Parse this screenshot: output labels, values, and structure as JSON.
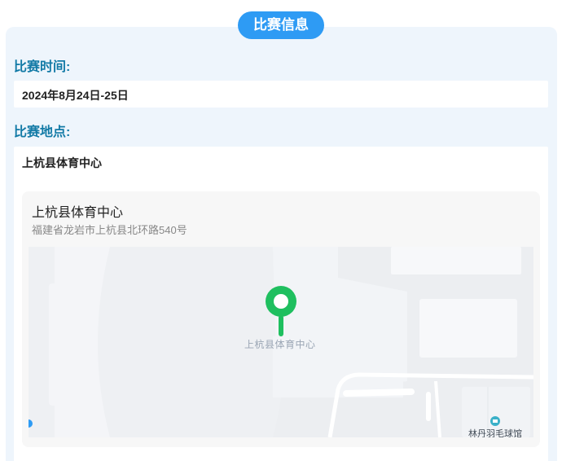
{
  "header": {
    "title": "比赛信息"
  },
  "time_section": {
    "label": "比赛时间:",
    "value": "2024年8月24日-25日"
  },
  "place_section": {
    "label": "比赛地点:",
    "value": "上杭县体育中心"
  },
  "map": {
    "title": "上杭县体育中心",
    "address": "福建省龙岩市上杭县北环路540号",
    "poi_label": "上杭县体育中心",
    "nearby_poi": "林丹羽毛球馆",
    "marker_color": "#1fbf5f",
    "accent_color": "#2e9bf4",
    "label_color": "#127aa6"
  }
}
